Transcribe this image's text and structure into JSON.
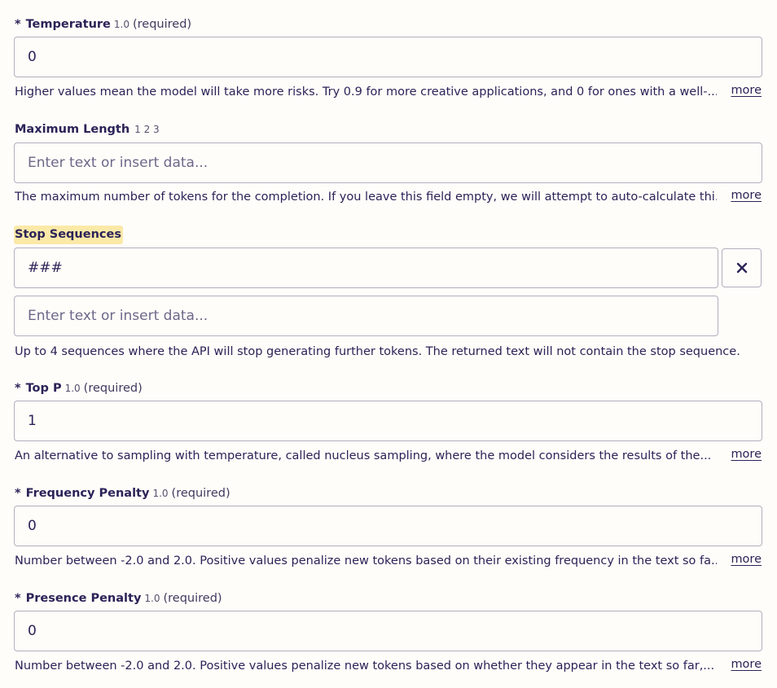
{
  "fields": {
    "temperature": {
      "required_mark": "*",
      "label": "Temperature",
      "version": "1.0",
      "required_text": "(required)",
      "value": "0",
      "help": "Higher values mean the model will take more risks. Try 0.9 for more creative applications, and 0 for ones with a well-...",
      "more": "more"
    },
    "max_length": {
      "label": "Maximum Length",
      "version": "1 2 3",
      "placeholder": "Enter text or insert data...",
      "help": "The maximum number of tokens for the completion. If you leave this field empty, we will attempt to auto-calculate thi...",
      "more": "more"
    },
    "stop_sequences": {
      "label": "Stop Sequences",
      "values": [
        "###"
      ],
      "placeholder": "Enter text or insert data...",
      "remove_icon": "close-icon",
      "help": "Up to 4 sequences where the API will stop generating further tokens. The returned text will not contain the stop sequence."
    },
    "top_p": {
      "required_mark": "*",
      "label": "Top P",
      "version": "1.0",
      "required_text": "(required)",
      "value": "1",
      "help": "An alternative to sampling with temperature, called nucleus sampling, where the model considers the results of the...",
      "more": "more"
    },
    "frequency_penalty": {
      "required_mark": "*",
      "label": "Frequency Penalty",
      "version": "1.0",
      "required_text": "(required)",
      "value": "0",
      "help": "Number between -2.0 and 2.0. Positive values penalize new tokens based on their existing frequency in the text so fa...",
      "more": "more"
    },
    "presence_penalty": {
      "required_mark": "*",
      "label": "Presence Penalty",
      "version": "1.0",
      "required_text": "(required)",
      "value": "0",
      "help": "Number between -2.0 and 2.0. Positive values penalize new tokens based on whether they appear in the text so far,...",
      "more": "more"
    }
  },
  "colors": {
    "text": "#2b2358",
    "border": "#b2afbd",
    "background": "#fffdf9",
    "highlight": "#fbe9a8"
  }
}
